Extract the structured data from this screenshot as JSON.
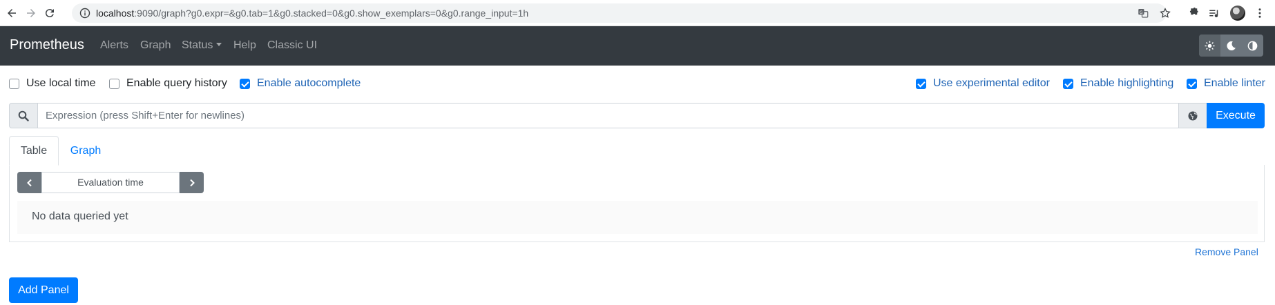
{
  "browser": {
    "url_host": "localhost",
    "url_rest": ":9090/graph?g0.expr=&g0.tab=1&g0.stacked=0&g0.show_exemplars=0&g0.range_input=1h"
  },
  "navbar": {
    "brand": "Prometheus",
    "links": [
      "Alerts",
      "Graph",
      "Status",
      "Help",
      "Classic UI"
    ]
  },
  "options": {
    "use_local_time": {
      "label": "Use local time",
      "checked": false
    },
    "enable_query_history": {
      "label": "Enable query history",
      "checked": false
    },
    "enable_autocomplete": {
      "label": "Enable autocomplete",
      "checked": true
    },
    "use_experimental_editor": {
      "label": "Use experimental editor",
      "checked": true
    },
    "enable_highlighting": {
      "label": "Enable highlighting",
      "checked": true
    },
    "enable_linter": {
      "label": "Enable linter",
      "checked": true
    }
  },
  "expression": {
    "placeholder": "Expression (press Shift+Enter for newlines)",
    "value": "",
    "execute_label": "Execute"
  },
  "tabs": {
    "table": "Table",
    "graph": "Graph",
    "active": "Table"
  },
  "panel": {
    "evaluation_time_placeholder": "Evaluation time",
    "no_data": "No data queried yet",
    "remove_label": "Remove Panel"
  },
  "add_panel_label": "Add Panel",
  "colors": {
    "navbar_bg": "#343a40",
    "primary": "#007bff",
    "secondary": "#6c757d"
  }
}
